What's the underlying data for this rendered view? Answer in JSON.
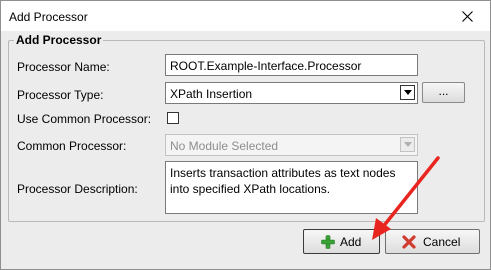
{
  "window": {
    "title": "Add Processor"
  },
  "group": {
    "legend": "Add Processor"
  },
  "fields": {
    "name_label": "Processor Name:",
    "name_value": "ROOT.Example-Interface.Processor",
    "type_label": "Processor Type:",
    "type_value": "XPath Insertion",
    "type_browse_label": "...",
    "use_common_label": "Use Common Processor:",
    "use_common_checked": false,
    "common_label": "Common Processor:",
    "common_value": "No Module Selected",
    "desc_label": "Processor Description:",
    "desc_value": "Inserts transaction attributes as text nodes into specified XPath locations."
  },
  "buttons": {
    "add_label": "Add",
    "cancel_label": "Cancel"
  },
  "icons": {
    "close": "close-icon",
    "add": "plus-icon",
    "cancel": "cancel-x-icon",
    "dropdown": "chevron-down-icon"
  },
  "colors": {
    "add_icon": "#3aa336",
    "cancel_icon": "#d13b2f",
    "annotation_arrow": "#e8251e"
  }
}
